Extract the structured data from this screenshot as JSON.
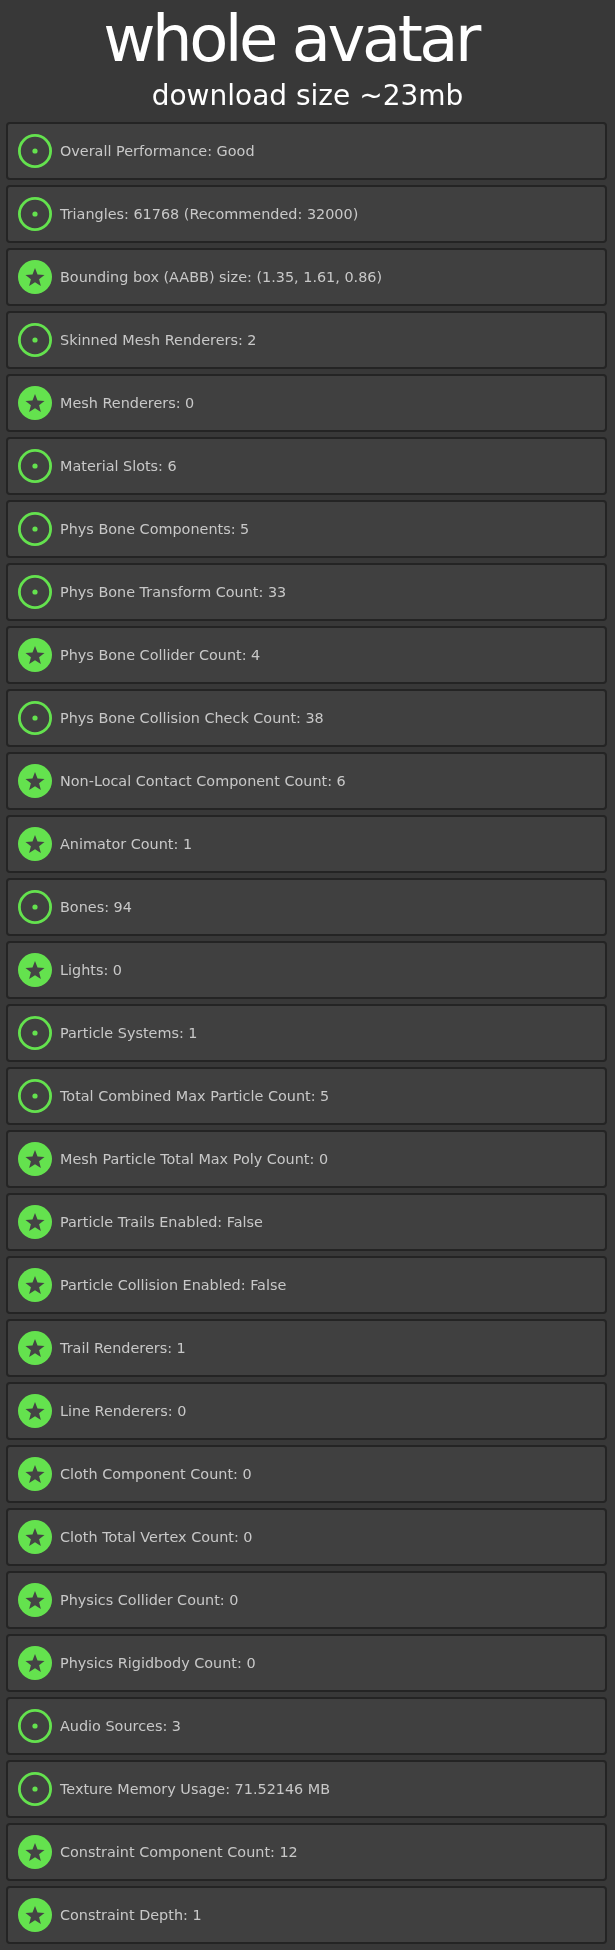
{
  "title": "whole avatar",
  "subtitle": "download size ~23mb",
  "items": [
    {
      "kind": "ring",
      "text": "Overall Performance: Good"
    },
    {
      "kind": "ring",
      "text": "Triangles: 61768 (Recommended: 32000)"
    },
    {
      "kind": "star",
      "text": "Bounding box (AABB) size: (1.35, 1.61, 0.86)"
    },
    {
      "kind": "ring",
      "text": "Skinned Mesh Renderers: 2"
    },
    {
      "kind": "star",
      "text": "Mesh Renderers: 0"
    },
    {
      "kind": "ring",
      "text": "Material Slots: 6"
    },
    {
      "kind": "ring",
      "text": "Phys Bone Components: 5"
    },
    {
      "kind": "ring",
      "text": "Phys Bone Transform Count: 33"
    },
    {
      "kind": "star",
      "text": "Phys Bone Collider Count: 4"
    },
    {
      "kind": "ring",
      "text": "Phys Bone Collision Check Count: 38"
    },
    {
      "kind": "star",
      "text": "Non-Local Contact Component Count: 6"
    },
    {
      "kind": "star",
      "text": "Animator Count: 1"
    },
    {
      "kind": "ring",
      "text": "Bones: 94"
    },
    {
      "kind": "star",
      "text": "Lights: 0"
    },
    {
      "kind": "ring",
      "text": "Particle Systems: 1"
    },
    {
      "kind": "ring",
      "text": "Total Combined Max Particle Count: 5"
    },
    {
      "kind": "star",
      "text": "Mesh Particle Total Max Poly Count: 0"
    },
    {
      "kind": "star",
      "text": "Particle Trails Enabled: False"
    },
    {
      "kind": "star",
      "text": "Particle Collision Enabled: False"
    },
    {
      "kind": "star",
      "text": "Trail Renderers: 1"
    },
    {
      "kind": "star",
      "text": "Line Renderers: 0"
    },
    {
      "kind": "star",
      "text": "Cloth Component Count: 0"
    },
    {
      "kind": "star",
      "text": "Cloth Total Vertex Count: 0"
    },
    {
      "kind": "star",
      "text": "Physics Collider Count: 0"
    },
    {
      "kind": "star",
      "text": "Physics Rigidbody Count: 0"
    },
    {
      "kind": "ring",
      "text": "Audio Sources: 3"
    },
    {
      "kind": "ring",
      "text": "Texture Memory Usage: 71.52146 MB"
    },
    {
      "kind": "star",
      "text": "Constraint Component Count: 12"
    },
    {
      "kind": "star",
      "text": "Constraint Depth: 1"
    }
  ]
}
